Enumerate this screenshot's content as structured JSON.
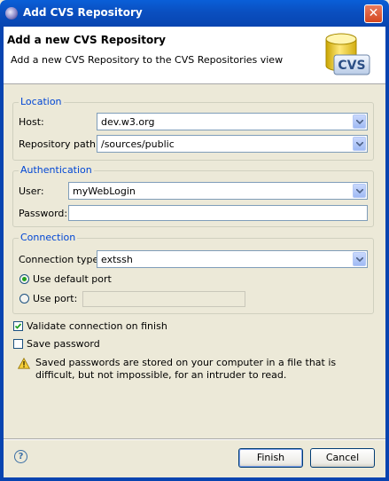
{
  "window": {
    "title": "Add CVS Repository",
    "close_glyph": "✕"
  },
  "header": {
    "title": "Add a new CVS Repository",
    "description": "Add a new CVS Repository to the CVS Repositories view",
    "logo_text": "CVS",
    "logo_icon": "cvs-database-icon"
  },
  "location": {
    "legend": "Location",
    "host_label": "Host:",
    "host_value": "dev.w3.org",
    "path_label": "Repository path:",
    "path_value": "/sources/public"
  },
  "authentication": {
    "legend": "Authentication",
    "user_label": "User:",
    "user_value": "myWebLogin",
    "password_label": "Password:",
    "password_value": ""
  },
  "connection": {
    "legend": "Connection",
    "type_label": "Connection type:",
    "type_value": "extssh",
    "default_port_label": "Use default port",
    "default_port_selected": true,
    "use_port_label": "Use port:",
    "use_port_selected": false,
    "port_value": ""
  },
  "options": {
    "validate_label": "Validate connection on finish",
    "validate_checked": true,
    "save_password_label": "Save password",
    "save_password_checked": false
  },
  "warning": {
    "icon": "warning-icon",
    "text": "Saved passwords are stored on your computer in a file that is difficult, but not impossible, for an intruder to read."
  },
  "buttons": {
    "finish": "Finish",
    "cancel": "Cancel",
    "help_glyph": "?"
  },
  "colors": {
    "titlebar": "#0a4fc0",
    "legend": "#0046d5",
    "dialog_bg": "#ece9d8",
    "header_bg": "#ffffff"
  }
}
